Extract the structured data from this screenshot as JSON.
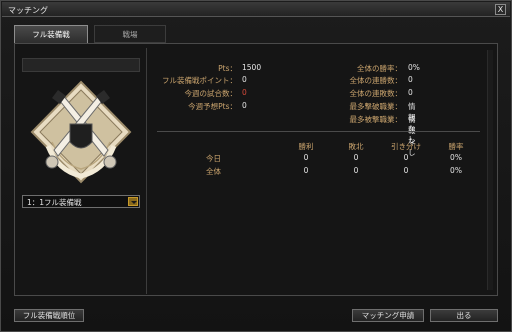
{
  "window": {
    "title": "マッチング",
    "close_label": "X"
  },
  "tabs": [
    {
      "label": "フル装備戦"
    },
    {
      "label": "戦場"
    }
  ],
  "selector": {
    "value": "1：1フル装備戦"
  },
  "stats_left": [
    {
      "label": "Pts：",
      "value": "1500"
    },
    {
      "label": "フル装備戦ポイント：",
      "value": "0"
    },
    {
      "label": "今週の試合数：",
      "value": "0"
    },
    {
      "label": "今週予想Pts：",
      "value": "0"
    }
  ],
  "stats_right": [
    {
      "label": "全体の勝率：",
      "value": "0%"
    },
    {
      "label": "全体の連勝数：",
      "value": "0"
    },
    {
      "label": "全体の連敗数：",
      "value": "0"
    },
    {
      "label": "最多撃破職業：",
      "value": "情報なし"
    },
    {
      "label": "最多被撃職業：",
      "value": "情報なし"
    }
  ],
  "record_table": {
    "headers": [
      "勝利",
      "敗北",
      "引き分け",
      "勝率"
    ],
    "rows": [
      {
        "label": "今日",
        "cells": [
          "0",
          "0",
          "0",
          "0%"
        ]
      },
      {
        "label": "全体",
        "cells": [
          "0",
          "0",
          "0",
          "0%"
        ]
      }
    ]
  },
  "buttons": {
    "ranking": "フル装備戦順位",
    "apply": "マッチング申請",
    "exit": "出る"
  },
  "colors": {
    "label_gold": "#c9a36d",
    "highlight_red": "#d64a3a",
    "accent_gold": "#c79a2a"
  }
}
